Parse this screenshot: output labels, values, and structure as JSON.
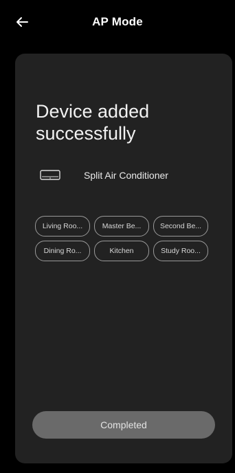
{
  "header": {
    "title": "AP Mode",
    "back_icon": "arrow-left-icon"
  },
  "main": {
    "heading": "Device added successfully",
    "device": {
      "icon": "air-conditioner-icon",
      "name": "Split Air Conditioner"
    },
    "rooms": [
      "Living Roo...",
      "Master Be...",
      "Second Be...",
      "Dining Ro...",
      "Kitchen",
      "Study Roo..."
    ],
    "complete_label": "Completed"
  },
  "colors": {
    "background": "#000000",
    "card": "#222222",
    "button": "#6a6a6a",
    "chip_border": "#9a9a9a"
  }
}
